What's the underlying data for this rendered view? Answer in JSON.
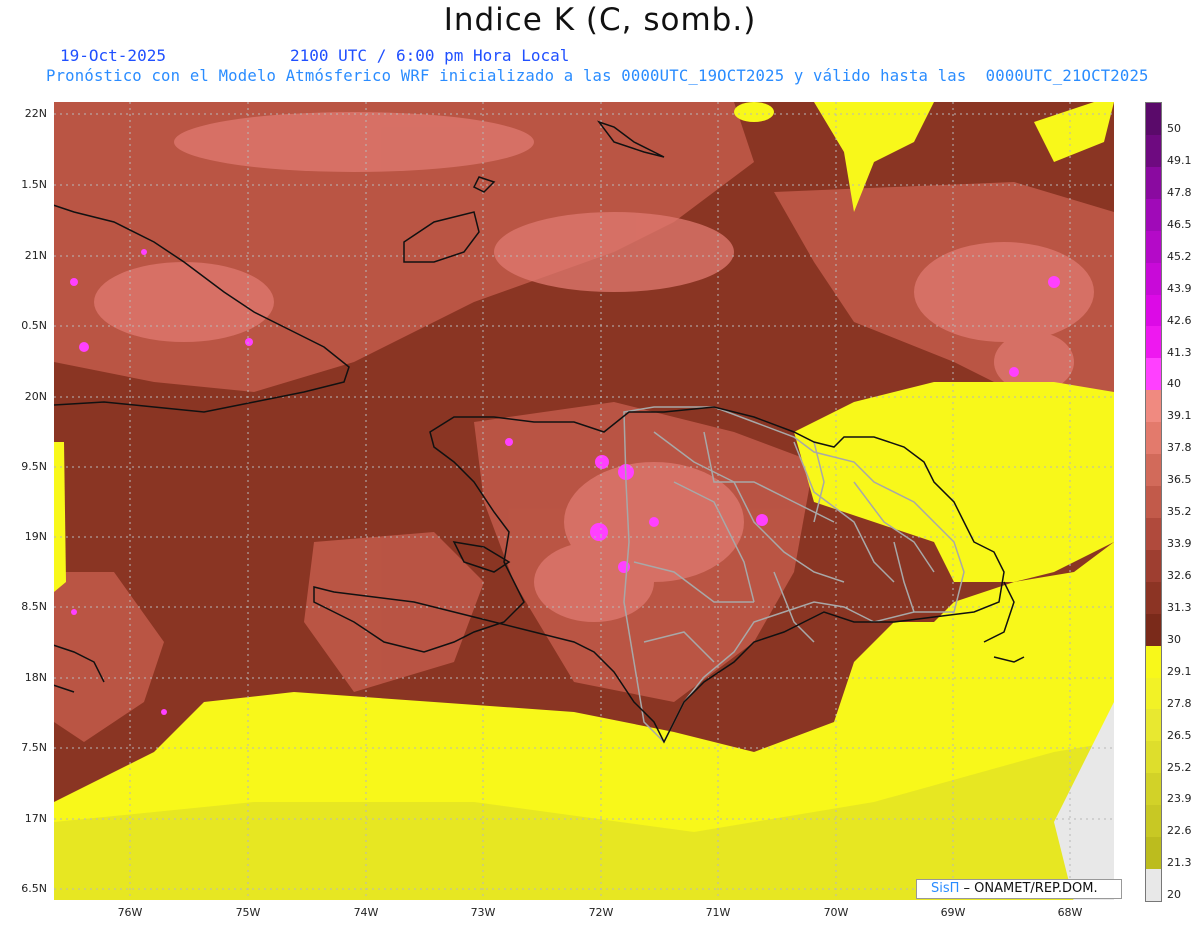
{
  "title": "Indice K (C, somb.)",
  "date": "19-Oct-2025",
  "time_label": "2100 UTC / 6:00 pm Hora Local",
  "forecast_line": "Pronóstico con el Modelo Atmósferico WRF inicializado a las 0000UTC_19OCT2025 y válido hasta las  0000UTC_21OCT2025",
  "credit": {
    "brand": "SisΠ",
    "text": " – ONAMET/REP.DOM."
  },
  "axes": {
    "lat_labels": [
      "22N",
      "1.5N",
      "21N",
      "0.5N",
      "20N",
      "9.5N",
      "19N",
      "8.5N",
      "18N",
      "7.5N",
      "17N",
      "6.5N"
    ],
    "lon_labels": [
      "76W",
      "75W",
      "74W",
      "73W",
      "72W",
      "71W",
      "70W",
      "69W",
      "68W"
    ]
  },
  "colorbar": {
    "labels": [
      "50",
      "49.1",
      "47.8",
      "46.5",
      "45.2",
      "43.9",
      "42.6",
      "41.3",
      "40",
      "39.1",
      "37.8",
      "36.5",
      "35.2",
      "33.9",
      "32.6",
      "31.3",
      "30",
      "29.1",
      "27.8",
      "26.5",
      "25.2",
      "23.9",
      "22.6",
      "21.3",
      "20"
    ],
    "colors": [
      "#5a0a6a",
      "#6e0a80",
      "#8a0aa0",
      "#a00ab8",
      "#b40ac8",
      "#c80ad8",
      "#dc0ae6",
      "#ee18f0",
      "#ff40ff",
      "#f08a80",
      "#e37a6c",
      "#d26a5a",
      "#c25a4a",
      "#b04a3c",
      "#9e3e30",
      "#8c3424",
      "#7a2a1a",
      "#f8f81a",
      "#f2f226",
      "#e8e830",
      "#dede2c",
      "#d2d228",
      "#c8c824",
      "#bcbc1e",
      "#e8e8e8"
    ]
  },
  "colors": {
    "sea_dark": "#8a3523",
    "warm": "#c25a4a",
    "pink": "#e07a70",
    "yellow": "#f8f81a",
    "yellow_dark": "#d8d82a",
    "magenta": "#ff40ff",
    "coast": "#111111",
    "borders": "#a8a8a8"
  }
}
